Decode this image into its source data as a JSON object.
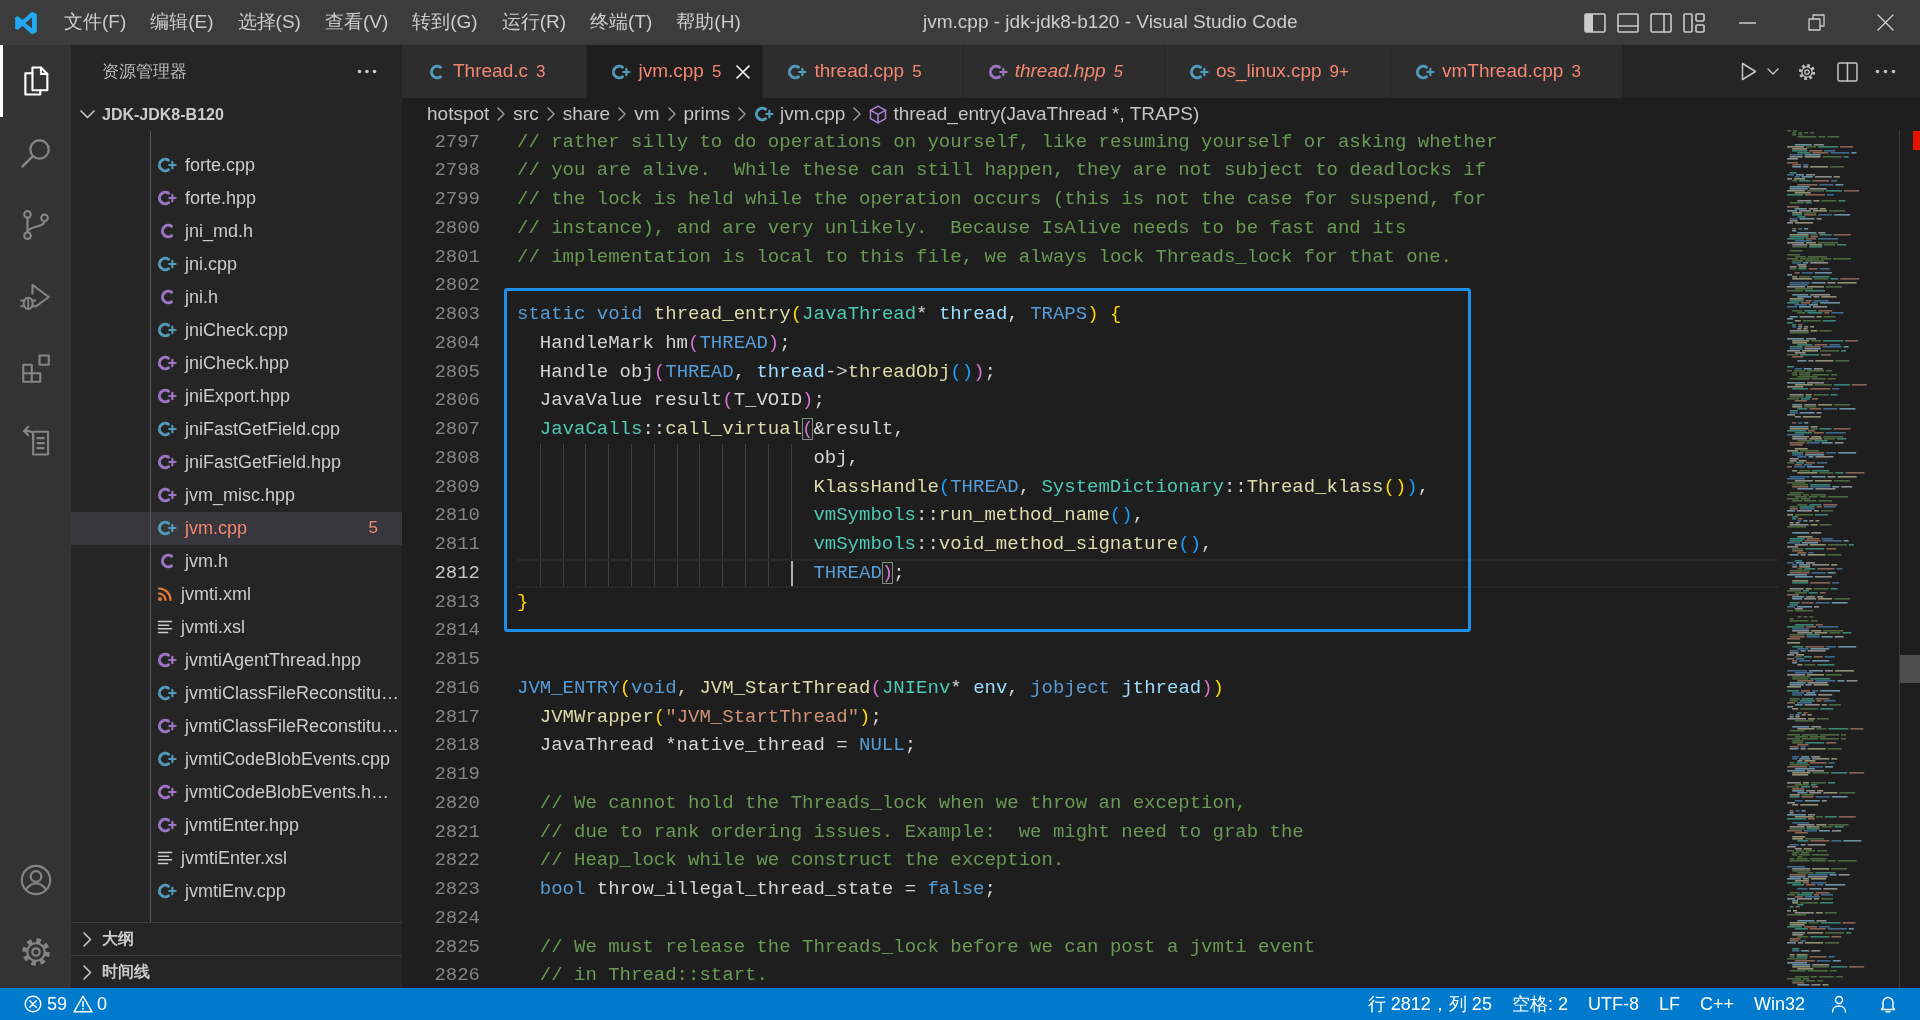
{
  "title_bar": {
    "menu": [
      "文件(F)",
      "编辑(E)",
      "选择(S)",
      "查看(V)",
      "转到(G)",
      "运行(R)",
      "终端(T)",
      "帮助(H)"
    ],
    "title": "jvm.cpp - jdk-jdk8-b120 - Visual Studio Code"
  },
  "activity_bar": {
    "items": [
      {
        "kind": "files",
        "selected": true
      },
      {
        "kind": "search",
        "selected": false
      },
      {
        "kind": "branch",
        "selected": false
      },
      {
        "kind": "debug",
        "selected": false
      },
      {
        "kind": "extensions",
        "selected": false
      },
      {
        "kind": "remote",
        "selected": false
      }
    ],
    "bottom": [
      {
        "kind": "account"
      },
      {
        "kind": "settings"
      }
    ]
  },
  "sidebar": {
    "title": "资源管理器",
    "root": {
      "label": "JDK-JDK8-B120",
      "expanded": true
    },
    "files": [
      {
        "name": "forte.cpp",
        "kind": "cpp",
        "selected": false,
        "errors": false
      },
      {
        "name": "forte.hpp",
        "kind": "hpp",
        "selected": false,
        "errors": false
      },
      {
        "name": "jni_md.h",
        "kind": "h",
        "selected": false,
        "errors": false
      },
      {
        "name": "jni.cpp",
        "kind": "cpp",
        "selected": false,
        "errors": false
      },
      {
        "name": "jni.h",
        "kind": "h",
        "selected": false,
        "errors": false
      },
      {
        "name": "jniCheck.cpp",
        "kind": "cpp",
        "selected": false,
        "errors": false
      },
      {
        "name": "jniCheck.hpp",
        "kind": "hpp",
        "selected": false,
        "errors": false
      },
      {
        "name": "jniExport.hpp",
        "kind": "hpp",
        "selected": false,
        "errors": false
      },
      {
        "name": "jniFastGetField.cpp",
        "kind": "cpp",
        "selected": false,
        "errors": false
      },
      {
        "name": "jniFastGetField.hpp",
        "kind": "hpp",
        "selected": false,
        "errors": false
      },
      {
        "name": "jvm_misc.hpp",
        "kind": "hpp",
        "selected": false,
        "errors": false
      },
      {
        "name": "jvm.cpp",
        "kind": "cpp",
        "selected": true,
        "errors": true,
        "badge": "5"
      },
      {
        "name": "jvm.h",
        "kind": "h",
        "selected": false,
        "errors": false
      },
      {
        "name": "jvmti.xml",
        "kind": "xml",
        "selected": false,
        "errors": false
      },
      {
        "name": "jvmti.xsl",
        "kind": "xsl",
        "selected": false,
        "errors": false
      },
      {
        "name": "jvmtiAgentThread.hpp",
        "kind": "hpp",
        "selected": false,
        "errors": false
      },
      {
        "name": "jvmtiClassFileReconstitu…",
        "kind": "cpp",
        "selected": false,
        "errors": false
      },
      {
        "name": "jvmtiClassFileReconstitu…",
        "kind": "hpp",
        "selected": false,
        "errors": false
      },
      {
        "name": "jvmtiCodeBlobEvents.cpp",
        "kind": "cpp",
        "selected": false,
        "errors": false
      },
      {
        "name": "jvmtiCodeBlobEvents.h…",
        "kind": "hpp",
        "selected": false,
        "errors": false
      },
      {
        "name": "jvmtiEnter.hpp",
        "kind": "hpp",
        "selected": false,
        "errors": false
      },
      {
        "name": "jvmtiEnter.xsl",
        "kind": "xsl",
        "selected": false,
        "errors": false
      },
      {
        "name": "jvmtiEnv.cpp",
        "kind": "cpp",
        "selected": false,
        "errors": false
      }
    ],
    "sections": [
      {
        "label": "大纲",
        "expanded": false
      },
      {
        "label": "时间线",
        "expanded": false
      }
    ]
  },
  "tabs": [
    {
      "label": "Thread.c",
      "kind": "c",
      "count": "3",
      "errors": true,
      "preview": false,
      "selected": false
    },
    {
      "label": "jvm.cpp",
      "kind": "cpp",
      "count": "5",
      "errors": true,
      "preview": false,
      "selected": true
    },
    {
      "label": "thread.cpp",
      "kind": "cpp",
      "count": "5",
      "errors": true,
      "preview": false,
      "selected": false
    },
    {
      "label": "thread.hpp",
      "kind": "hpp",
      "count": "5",
      "errors": true,
      "preview": true,
      "selected": false
    },
    {
      "label": "os_linux.cpp",
      "kind": "cpp",
      "count": "9+",
      "errors": true,
      "preview": false,
      "selected": false
    },
    {
      "label": "vmThread.cpp",
      "kind": "cpp",
      "count": "3",
      "errors": true,
      "preview": false,
      "selected": false
    }
  ],
  "breadcrumb": [
    {
      "label": "hotspot",
      "kind": "folder"
    },
    {
      "label": "src",
      "kind": "folder"
    },
    {
      "label": "share",
      "kind": "folder"
    },
    {
      "label": "vm",
      "kind": "folder"
    },
    {
      "label": "prims",
      "kind": "folder"
    },
    {
      "label": "jvm.cpp",
      "kind": "file"
    },
    {
      "label": "thread_entry(JavaThread *, TRAPS)",
      "kind": "symbol"
    }
  ],
  "editor": {
    "blocks": [
      {
        "boxed": false,
        "lines": [
          {
            "number": "2797",
            "active": false,
            "tokens": [
              {
                "text": "// rather silly to do operations on yourself, like resuming yourself or asking whether",
                "kind": "comment"
              }
            ]
          },
          {
            "number": "2798",
            "active": false,
            "tokens": [
              {
                "text": "// you are alive.  While these can still happen, they are not subject to deadlocks if",
                "kind": "comment"
              }
            ]
          },
          {
            "number": "2799",
            "active": false,
            "tokens": [
              {
                "text": "// the lock is held while the operation occurs (this is not the case for suspend, for",
                "kind": "comment"
              }
            ]
          },
          {
            "number": "2800",
            "active": false,
            "tokens": [
              {
                "text": "// instance), and are very unlikely.  Because IsAlive needs to be fast and its",
                "kind": "comment"
              }
            ]
          },
          {
            "number": "2801",
            "active": false,
            "tokens": [
              {
                "text": "// implementation is local to this file, we always lock Threads_lock for that one.",
                "kind": "comment"
              }
            ]
          },
          {
            "number": "2802",
            "active": false
          }
        ]
      },
      {
        "boxed": true,
        "lines": [
          {
            "number": "2803",
            "active": false,
            "tokens": [
              {
                "text": "static ",
                "kind": "keyword"
              },
              {
                "text": "void ",
                "kind": "keyword"
              },
              {
                "text": "thread_entry",
                "kind": "function"
              },
              {
                "text": "(",
                "kind": "bracket1"
              },
              {
                "text": "JavaThread",
                "kind": "type"
              },
              {
                "text": "* ",
                "kind": "plain"
              },
              {
                "text": "thread",
                "kind": "param"
              },
              {
                "text": ", ",
                "kind": "plain"
              },
              {
                "text": "TRAPS",
                "kind": "keyword"
              },
              {
                "text": ") {",
                "kind": "bracket1"
              }
            ]
          },
          {
            "number": "2804",
            "active": false,
            "tokens": [
              {
                "text": "  HandleMark hm",
                "kind": "plain"
              },
              {
                "text": "(",
                "kind": "bracket2"
              },
              {
                "text": "THREAD",
                "kind": "keyword"
              },
              {
                "text": ")",
                "kind": "bracket2"
              },
              {
                "text": ";",
                "kind": "plain"
              }
            ]
          },
          {
            "number": "2805",
            "active": false,
            "tokens": [
              {
                "text": "  Handle obj",
                "kind": "plain"
              },
              {
                "text": "(",
                "kind": "bracket2"
              },
              {
                "text": "THREAD",
                "kind": "keyword"
              },
              {
                "text": ", ",
                "kind": "plain"
              },
              {
                "text": "thread",
                "kind": "param"
              },
              {
                "text": "->",
                "kind": "plain"
              },
              {
                "text": "threadObj",
                "kind": "function"
              },
              {
                "text": "()",
                "kind": "bracket3"
              },
              {
                "text": ")",
                "kind": "bracket2"
              },
              {
                "text": ";",
                "kind": "plain"
              }
            ]
          },
          {
            "number": "2806",
            "active": false,
            "tokens": [
              {
                "text": "  JavaValue result",
                "kind": "plain"
              },
              {
                "text": "(",
                "kind": "bracket2"
              },
              {
                "text": "T_VOID",
                "kind": "plain"
              },
              {
                "text": ")",
                "kind": "bracket2"
              },
              {
                "text": ";",
                "kind": "plain"
              }
            ]
          },
          {
            "number": "2807",
            "active": false,
            "tokens": [
              {
                "text": "  JavaCalls",
                "kind": "type"
              },
              {
                "text": "::",
                "kind": "plain"
              },
              {
                "text": "call_virtual",
                "kind": "function"
              },
              {
                "text": "(",
                "kind": "bracketmatch"
              },
              {
                "text": "&result,",
                "kind": "plain"
              }
            ]
          },
          {
            "number": "2808",
            "active": false,
            "tokens": [
              {
                "text": "                          obj,",
                "kind": "plain"
              }
            ]
          },
          {
            "number": "2809",
            "active": false,
            "tokens": [
              {
                "text": "                          KlassHandle",
                "kind": "function"
              },
              {
                "text": "(",
                "kind": "bracket3"
              },
              {
                "text": "THREAD",
                "kind": "keyword"
              },
              {
                "text": ", ",
                "kind": "plain"
              },
              {
                "text": "SystemDictionary",
                "kind": "type"
              },
              {
                "text": "::",
                "kind": "plain"
              },
              {
                "text": "Thread_klass",
                "kind": "function"
              },
              {
                "text": "()",
                "kind": "bracket1"
              },
              {
                "text": ")",
                "kind": "bracket3"
              },
              {
                "text": ",",
                "kind": "plain"
              }
            ]
          },
          {
            "number": "2810",
            "active": false,
            "tokens": [
              {
                "text": "                          vmSymbols",
                "kind": "type"
              },
              {
                "text": "::",
                "kind": "plain"
              },
              {
                "text": "run_method_name",
                "kind": "function"
              },
              {
                "text": "()",
                "kind": "bracket3"
              },
              {
                "text": ",",
                "kind": "plain"
              }
            ]
          },
          {
            "number": "2811",
            "active": false,
            "tokens": [
              {
                "text": "                          vmSymbols",
                "kind": "type"
              },
              {
                "text": "::",
                "kind": "plain"
              },
              {
                "text": "void_method_signature",
                "kind": "function"
              },
              {
                "text": "()",
                "kind": "bracket3"
              },
              {
                "text": ",",
                "kind": "plain"
              }
            ]
          },
          {
            "number": "2812",
            "active": true,
            "tokens": [
              {
                "text": "                          THREAD",
                "kind": "keyword"
              },
              {
                "text": ")",
                "kind": "bracketmatch"
              },
              {
                "text": ";",
                "kind": "plain"
              }
            ]
          },
          {
            "number": "2813",
            "active": false,
            "tokens": [
              {
                "text": "}",
                "kind": "bracket1"
              }
            ]
          }
        ]
      },
      {
        "boxed": false,
        "lines": [
          {
            "number": "2814",
            "active": false
          },
          {
            "number": "2815",
            "active": false
          },
          {
            "number": "2816",
            "active": false,
            "tokens": [
              {
                "text": "JVM_ENTRY",
                "kind": "keyword"
              },
              {
                "text": "(",
                "kind": "bracket1"
              },
              {
                "text": "void",
                "kind": "keyword"
              },
              {
                "text": ", ",
                "kind": "plain"
              },
              {
                "text": "JVM_StartThread",
                "kind": "function"
              },
              {
                "text": "(",
                "kind": "bracket2"
              },
              {
                "text": "JNIEnv",
                "kind": "type"
              },
              {
                "text": "* ",
                "kind": "plain"
              },
              {
                "text": "env",
                "kind": "param"
              },
              {
                "text": ", ",
                "kind": "plain"
              },
              {
                "text": "jobject ",
                "kind": "keyword"
              },
              {
                "text": "jthread",
                "kind": "param"
              },
              {
                "text": ")",
                "kind": "bracket2"
              },
              {
                "text": ")",
                "kind": "bracket1"
              }
            ]
          },
          {
            "number": "2817",
            "active": false,
            "tokens": [
              {
                "text": "  JVMWrapper",
                "kind": "function"
              },
              {
                "text": "(",
                "kind": "bracket1"
              },
              {
                "text": "\"JVM_StartThread\"",
                "kind": "string"
              },
              {
                "text": ")",
                "kind": "bracket1"
              },
              {
                "text": ";",
                "kind": "plain"
              }
            ]
          },
          {
            "number": "2818",
            "active": false,
            "tokens": [
              {
                "text": "  JavaThread *native_thread = ",
                "kind": "plain"
              },
              {
                "text": "NULL",
                "kind": "keyword"
              },
              {
                "text": ";",
                "kind": "plain"
              }
            ]
          },
          {
            "number": "2819",
            "active": false
          },
          {
            "number": "2820",
            "active": false,
            "tokens": [
              {
                "text": "  // We cannot hold the Threads_lock when we throw an exception,",
                "kind": "comment"
              }
            ]
          },
          {
            "number": "2821",
            "active": false,
            "tokens": [
              {
                "text": "  // due to rank ordering issues. Example:  we might need to grab the",
                "kind": "comment"
              }
            ]
          },
          {
            "number": "2822",
            "active": false,
            "tokens": [
              {
                "text": "  // Heap_lock while we construct the exception.",
                "kind": "comment"
              }
            ]
          },
          {
            "number": "2823",
            "active": false,
            "tokens": [
              {
                "text": "  bool",
                "kind": "keyword"
              },
              {
                "text": " throw_illegal_thread_state = ",
                "kind": "plain"
              },
              {
                "text": "false",
                "kind": "keyword"
              },
              {
                "text": ";",
                "kind": "plain"
              }
            ]
          },
          {
            "number": "2824",
            "active": false
          },
          {
            "number": "2825",
            "active": false,
            "tokens": [
              {
                "text": "  // We must release the Threads_lock before we can post a jvmti event",
                "kind": "comment"
              }
            ]
          },
          {
            "number": "2826",
            "active": false,
            "tokens": [
              {
                "text": "  // in Thread::start.",
                "kind": "comment"
              }
            ]
          }
        ]
      }
    ]
  },
  "status_bar": {
    "errors": "59",
    "warnings": "0",
    "items": [
      "行 2812，列 25",
      "空格: 2",
      "UTF-8",
      "LF",
      "C++",
      "Win32"
    ]
  }
}
